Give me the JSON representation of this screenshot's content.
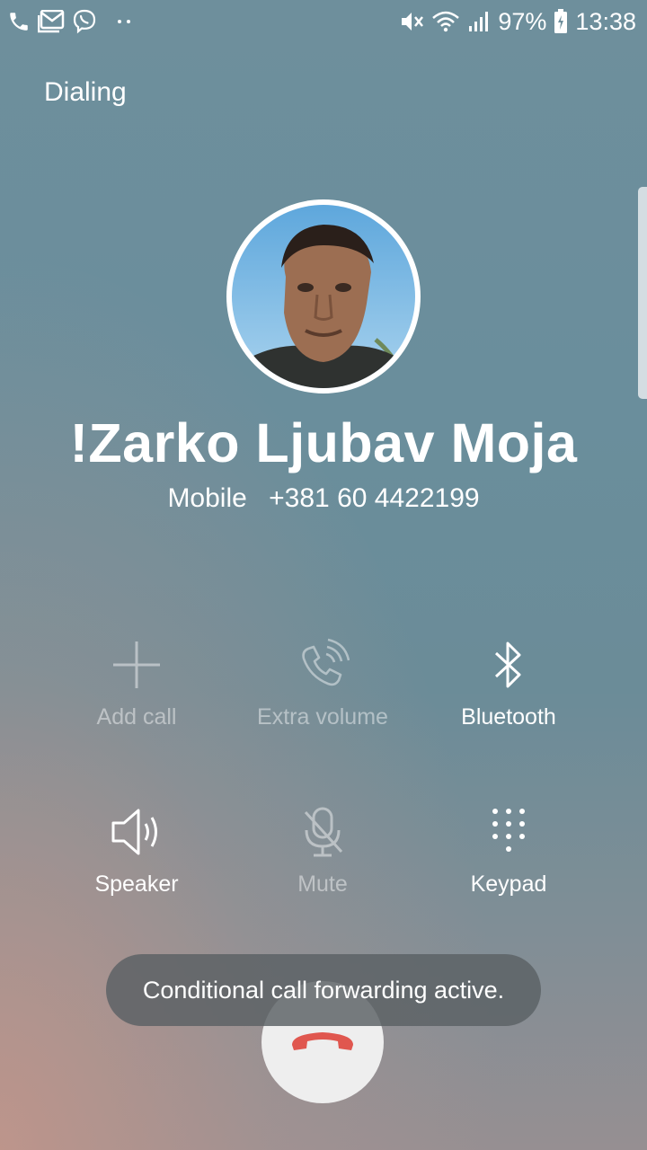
{
  "status_bar": {
    "left_icons": [
      "phone-icon",
      "email-icon",
      "viber-icon",
      "more-notifications-icon"
    ],
    "right_icons": [
      "mute-icon",
      "wifi-icon",
      "signal-icon",
      "battery-charging-icon"
    ],
    "battery": "97%",
    "time": "13:38"
  },
  "call": {
    "state": "Dialing",
    "contact_name": "!Zarko Ljubav Moja",
    "number_type": "Mobile",
    "number": "+381 60 4422199"
  },
  "actions": [
    {
      "label": "Add call",
      "icon": "plus-icon",
      "enabled": false
    },
    {
      "label": "Extra volume",
      "icon": "extra-volume-icon",
      "enabled": false
    },
    {
      "label": "Bluetooth",
      "icon": "bluetooth-icon",
      "enabled": true
    },
    {
      "label": "Speaker",
      "icon": "speaker-icon",
      "enabled": true
    },
    {
      "label": "Mute",
      "icon": "mute-mic-icon",
      "enabled": false
    },
    {
      "label": "Keypad",
      "icon": "keypad-icon",
      "enabled": true
    }
  ],
  "end_call": {
    "icon": "end-call-icon",
    "color": "#e0574f"
  },
  "toast": {
    "message": "Conditional call forwarding active."
  }
}
